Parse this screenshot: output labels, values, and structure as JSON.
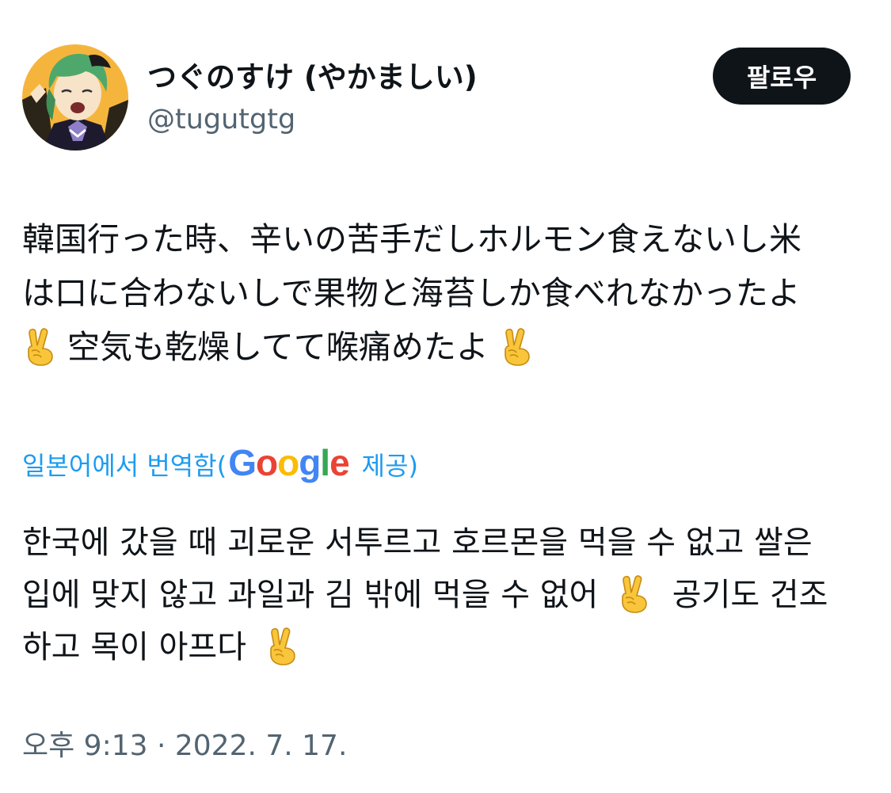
{
  "author": {
    "display_name": "つぐのすけ (やかましい)",
    "handle": "@tugutgtg",
    "avatar_icon": "anime-character-avatar"
  },
  "follow_button": {
    "label": "팔로우"
  },
  "tweet": {
    "lines": [
      "韓国行った時、辛いの苦手だしホルモン食えないし米",
      "は口に合わないしで果物と海苔しか食べれなかったよ",
      "空気も乾燥してて喉痛めたよ"
    ],
    "emoji": "victory-hand-emoji"
  },
  "translation": {
    "prefix": "일본어에서 번역함(",
    "provider_logo": "Google",
    "suffix": "제공)",
    "lines": [
      "한국에 갔을 때 괴로운 서투르고 호르몬을 먹을 수 없고 쌀은",
      "입에 맞지 않고 과일과 김 밖에 먹을 수 없어",
      "공기도 건조",
      "하고 목이 아프다"
    ]
  },
  "timestamp": "오후 9:13 · 2022. 7. 17.",
  "colors": {
    "text": "#0f1419",
    "secondary": "#536471",
    "link": "#1d9bf0",
    "button_bg": "#0f1419",
    "avatar_bg": "#f5b53d"
  }
}
